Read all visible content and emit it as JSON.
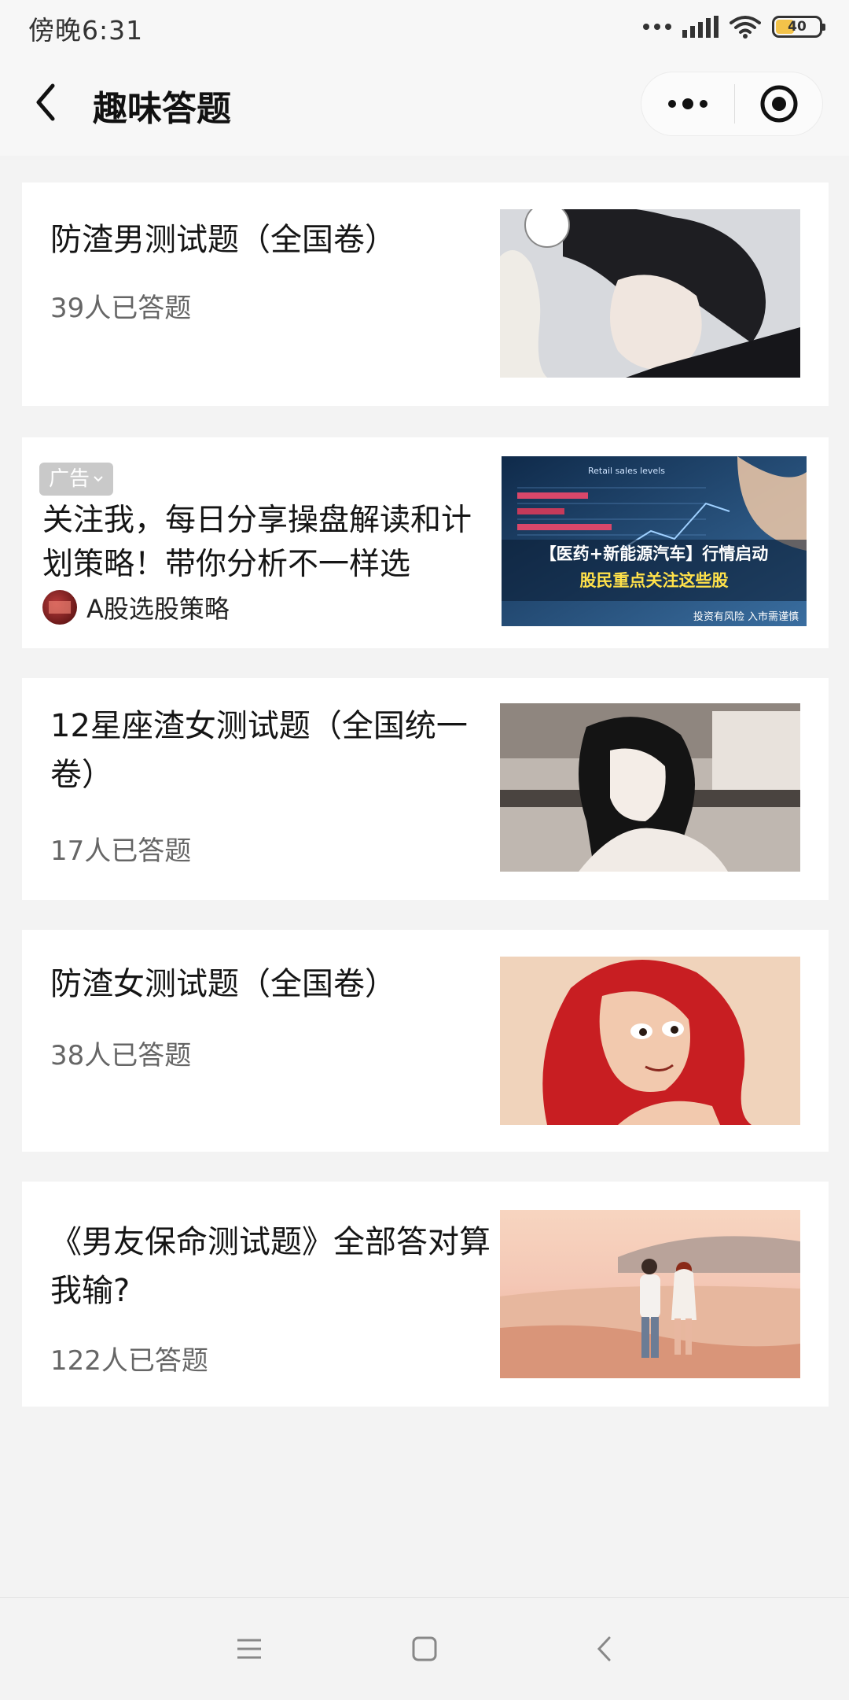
{
  "status_bar": {
    "time": "傍晚6:31",
    "battery": "40"
  },
  "nav": {
    "title": "趣味答题"
  },
  "quizzes": [
    {
      "title": "防渣男测试题（全国卷）",
      "count": "39人已答题"
    },
    {
      "title": "12星座渣女测试题（全国统一卷）",
      "count": "17人已答题"
    },
    {
      "title": "防渣女测试题（全国卷）",
      "count": "38人已答题"
    },
    {
      "title": "《男友保命测试题》全部答对算我输?",
      "count": "122人已答题"
    }
  ],
  "ad": {
    "badge": "广告",
    "title": "关注我，每日分享操盘解读和计划策略！带你分析不一样选",
    "brand": "A股选股策略",
    "image_caption_1": "【医药+新能源汽车】行情启动",
    "image_caption_2": "股民重点关注这些股",
    "image_disclaimer": "投资有风险 入市需谨慎",
    "image_chart_title": "Retail sales levels"
  },
  "colors": {
    "background": "#f3f3f3",
    "card": "#ffffff",
    "ad_caption_yellow": "#ffe14a",
    "ad_badge": "#c9c9c9"
  }
}
